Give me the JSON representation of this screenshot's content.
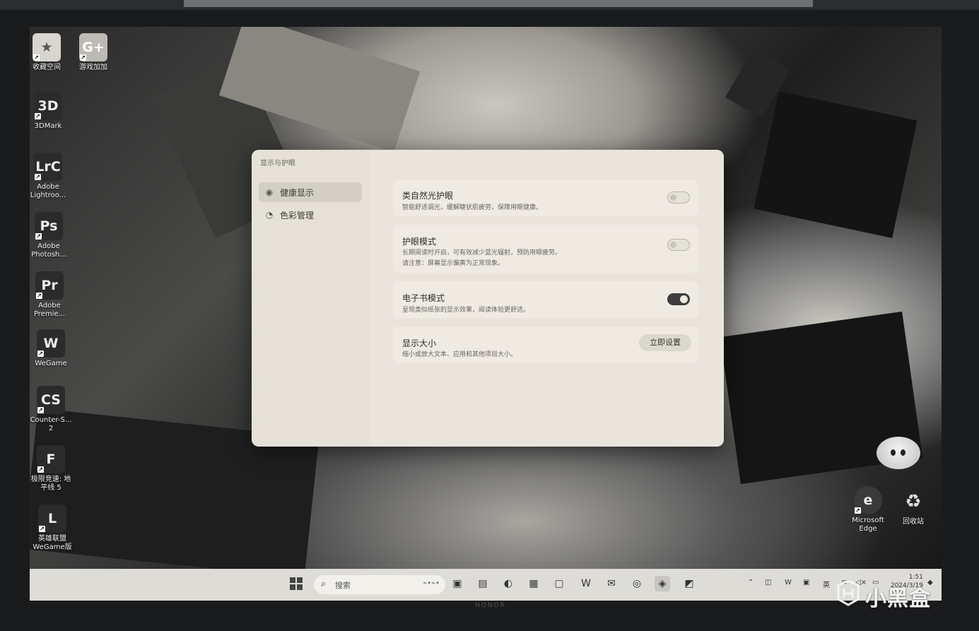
{
  "desktop": {
    "icons": [
      {
        "label": "收藏空间",
        "glyph": "★",
        "style": "light"
      },
      {
        "label": "游戏加加",
        "glyph": "G+",
        "style": "light"
      },
      {
        "label": "3DMark",
        "glyph": "3D",
        "style": "dark"
      },
      {
        "label": "Adobe Lightroo...",
        "glyph": "LrC",
        "style": "dark"
      },
      {
        "label": "Adobe Photosh...",
        "glyph": "Ps",
        "style": "dark"
      },
      {
        "label": "Adobe Premie...",
        "glyph": "Pr",
        "style": "dark"
      },
      {
        "label": "WeGame",
        "glyph": "W",
        "style": "dark"
      },
      {
        "label": "Counter-S... 2",
        "glyph": "CS",
        "style": "dark"
      },
      {
        "label": "极限竞速: 地平线 5",
        "glyph": "F",
        "style": "dark"
      },
      {
        "label": "英雄联盟 WeGame版",
        "glyph": "L",
        "style": "dark"
      },
      {
        "label": "Microsoft Edge",
        "glyph": "e",
        "style": "dark"
      },
      {
        "label": "回收站",
        "glyph": "♻",
        "style": "dark"
      }
    ]
  },
  "window": {
    "title": "显示与护眼",
    "minimize_glyph": "—",
    "close_glyph": "✕",
    "sidebar": [
      {
        "label": "健康显示",
        "icon": "eye-icon",
        "glyph": "◉",
        "active": true
      },
      {
        "label": "色彩管理",
        "icon": "palette-icon",
        "glyph": "◔",
        "active": false
      }
    ],
    "cards": [
      {
        "title": "类自然光护眼",
        "desc": [
          "智能舒适调光，缓解睫状肌疲劳，保障用眼健康。"
        ],
        "toggle": "off"
      },
      {
        "title": "护眼模式",
        "desc": [
          "长期阅读时开启，可有效减少蓝光辐射，预防用眼疲劳。",
          "请注意：屏幕显示偏黄为正常现象。"
        ],
        "toggle": "off"
      },
      {
        "title": "电子书模式",
        "desc": [
          "呈现类似纸张的显示效果，阅读体验更舒适。"
        ],
        "toggle": "on"
      },
      {
        "title": "显示大小",
        "desc": [
          "缩小或放大文本、应用和其他项目大小。"
        ],
        "button": "立即设置"
      }
    ]
  },
  "taskbar": {
    "search_placeholder": "搜索",
    "search_deco": "⌁•⌁•",
    "tray": {
      "ime": "英",
      "time": "1:51",
      "date": "2024/3/19"
    }
  },
  "watermark": "小黑盒",
  "brand": "HONOR"
}
